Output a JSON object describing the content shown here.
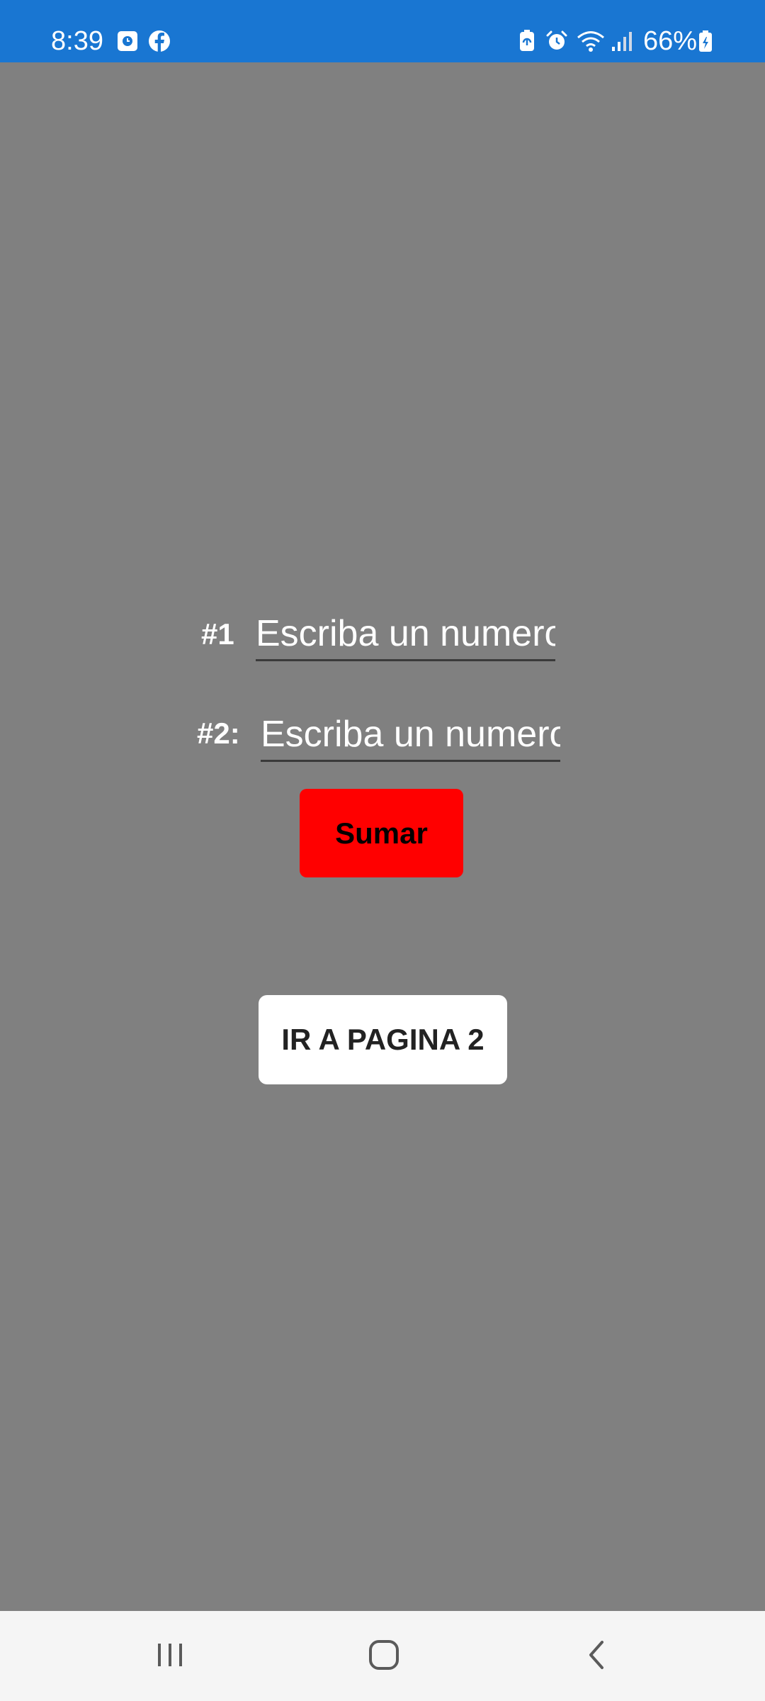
{
  "status_bar": {
    "time": "8:39",
    "battery": "66%",
    "left_icons": [
      "notification-app-icon",
      "facebook-icon"
    ],
    "right_icons": [
      "battery-saver-icon",
      "alarm-icon",
      "wifi-icon",
      "signal-icon",
      "battery-charging-icon"
    ],
    "color": "#1976d2"
  },
  "form": {
    "label_1": "#1",
    "input_1_placeholder": "Escriba un numero",
    "label_2": "#2:",
    "input_2_placeholder": "Escriba un numero",
    "sumar_label": "Sumar",
    "sumar_color": "#ff0000",
    "page2_label": "IR A PAGINA 2"
  },
  "nav_bar": {
    "icons": [
      "recent-apps-icon",
      "home-icon",
      "back-icon"
    ]
  },
  "background_color": "#808080"
}
